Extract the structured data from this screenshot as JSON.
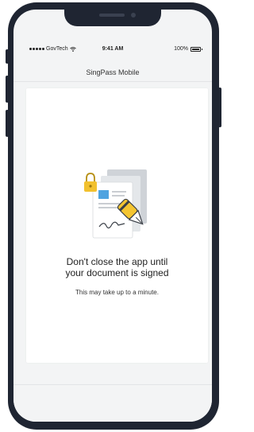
{
  "status_bar": {
    "carrier": "GovTech",
    "time": "9:41 AM",
    "battery_text": "100%",
    "battery_level": 1.0
  },
  "navigation": {
    "title": "SingPass Mobile"
  },
  "message": {
    "headline_line1": "Don't close the app until",
    "headline_line2": "your document is signed",
    "subtext": "This may take up to a minute."
  },
  "icons": {
    "signal": "signal-dots-icon",
    "wifi": "wifi-icon",
    "battery": "battery-icon",
    "illustration": "document-signing-icon",
    "lock": "padlock-icon",
    "pen": "fountain-pen-icon"
  },
  "colors": {
    "frame": "#1f2532",
    "screen_background": "#f3f4f5",
    "card_background": "#ffffff",
    "lock_yellow": "#f2c12e",
    "pen_yellow": "#f4c531",
    "doc_blue": "#4fa3e0"
  }
}
